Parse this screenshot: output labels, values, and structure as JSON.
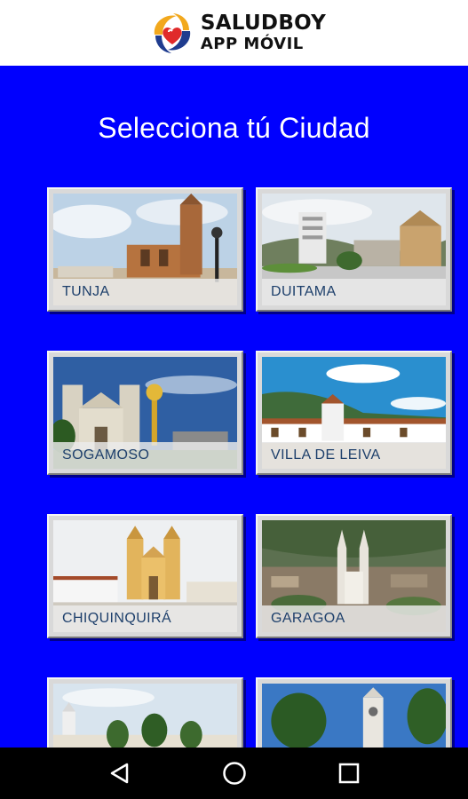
{
  "header": {
    "brand_title": "SALUDBOY",
    "brand_subtitle": "APP MÓVIL",
    "logo_icon": "heart-hands-logo"
  },
  "main": {
    "title": "Selecciona tú Ciudad",
    "background_color": "#0000fe",
    "cities": [
      {
        "label": "TUNJA"
      },
      {
        "label": "DUITAMA"
      },
      {
        "label": "SOGAMOSO"
      },
      {
        "label": "VILLA DE LEIVA"
      },
      {
        "label": "CHIQUINQUIRÁ"
      },
      {
        "label": "GARAGOA"
      },
      {
        "label": ""
      },
      {
        "label": ""
      }
    ]
  },
  "navbar": {
    "back_icon": "back-triangle-icon",
    "home_icon": "home-circle-icon",
    "recents_icon": "recents-square-icon"
  }
}
